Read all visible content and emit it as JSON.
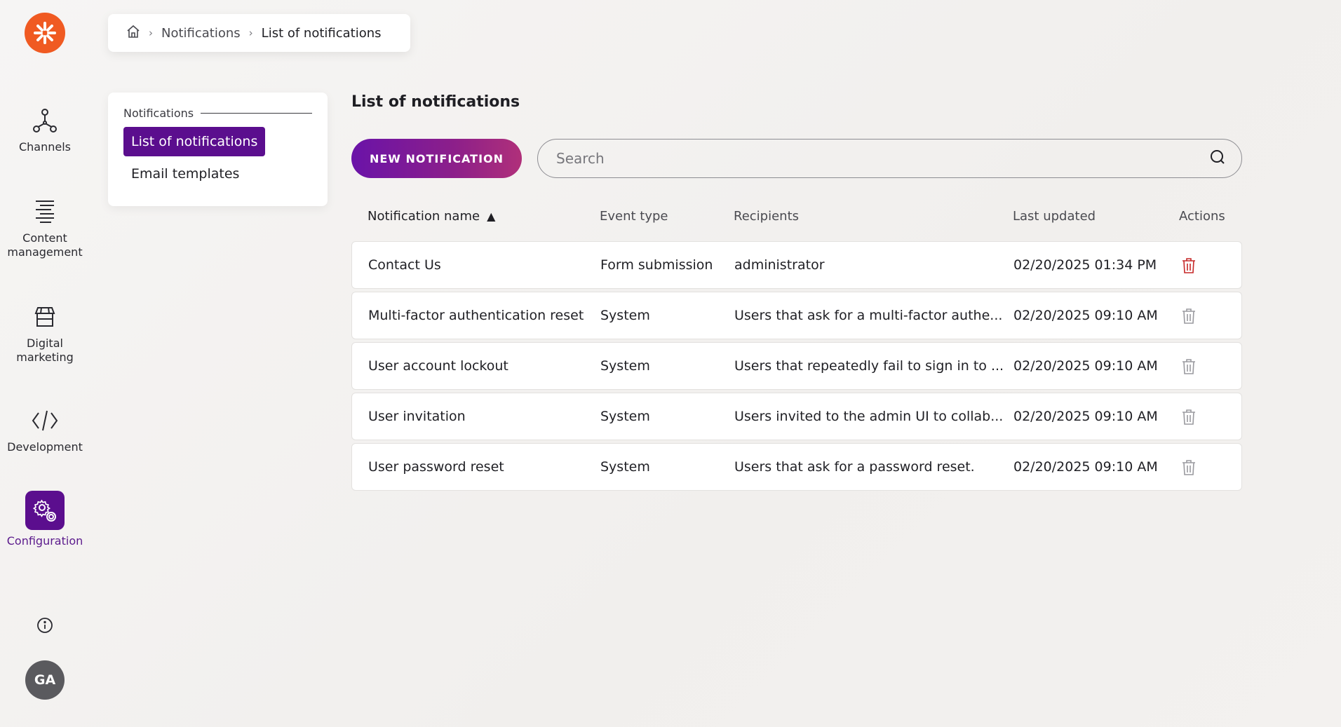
{
  "rail": {
    "items": [
      {
        "label": "Channels",
        "icon": "channels-icon"
      },
      {
        "label": "Content\nmanagement",
        "icon": "content-icon"
      },
      {
        "label": "Digital\nmarketing",
        "icon": "store-icon"
      },
      {
        "label": "Development",
        "icon": "code-icon"
      },
      {
        "label": "Configuration",
        "icon": "gear-icon",
        "active": true
      }
    ],
    "avatar": "GA"
  },
  "breadcrumb": {
    "items": [
      "Notifications",
      "List of notifications"
    ]
  },
  "subnav": {
    "heading": "Notifications",
    "items": [
      {
        "label": "List of notifications",
        "active": true
      },
      {
        "label": "Email templates"
      }
    ]
  },
  "main": {
    "title": "List of notifications",
    "new_button": "NEW NOTIFICATION",
    "search_placeholder": "Search",
    "columns": {
      "name": "Notification name",
      "event": "Event type",
      "recipients": "Recipients",
      "updated": "Last updated",
      "actions": "Actions"
    },
    "rows": [
      {
        "name": "Contact Us",
        "event": "Form submission",
        "recipients": "administrator",
        "updated": "02/20/2025 01:34 PM",
        "delete_enabled": true
      },
      {
        "name": "Multi-factor authentication reset",
        "event": "System",
        "recipients": "Users that ask for a multi-factor authe...",
        "updated": "02/20/2025 09:10 AM",
        "delete_enabled": false
      },
      {
        "name": "User account lockout",
        "event": "System",
        "recipients": "Users that repeatedly fail to sign in to ...",
        "updated": "02/20/2025 09:10 AM",
        "delete_enabled": false
      },
      {
        "name": "User invitation",
        "event": "System",
        "recipients": "Users invited to the admin UI to collab...",
        "updated": "02/20/2025 09:10 AM",
        "delete_enabled": false
      },
      {
        "name": "User password reset",
        "event": "System",
        "recipients": "Users that ask for a password reset.",
        "updated": "02/20/2025 09:10 AM",
        "delete_enabled": false
      }
    ]
  },
  "colors": {
    "accent": "#5b0e8e",
    "logo": "#f05a22",
    "delete_active": "#c62828",
    "delete_disabled": "#9a9a9f"
  }
}
